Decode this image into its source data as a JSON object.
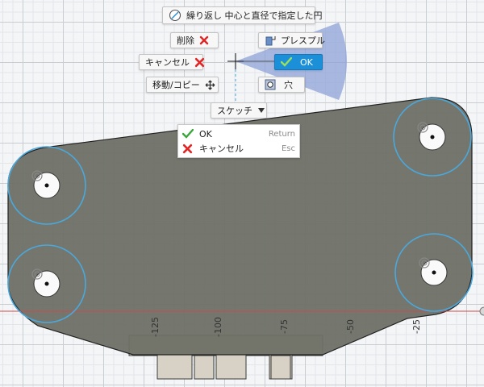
{
  "command_title": "繰り返し 中心と直径で指定した円",
  "buttons": {
    "delete": "削除",
    "cancel": "キャンセル",
    "move_copy": "移動/コピー",
    "press_pull": "プレスプル",
    "ok": "OK",
    "hole": "穴",
    "sketch": "スケッチ"
  },
  "menu": {
    "items": [
      {
        "label": "OK",
        "shortcut": "Return",
        "icon": "check-icon"
      },
      {
        "label": "キャンセル",
        "shortcut": "Esc",
        "icon": "cross-icon"
      }
    ]
  },
  "axis_labels": [
    "-125",
    "-100",
    "-75",
    "-50",
    "-25"
  ],
  "colors": {
    "body": "#6e7066",
    "circle": "#4aa8dc",
    "ok_button": "#1c8fd9",
    "axis_line": "#d04a4a"
  }
}
